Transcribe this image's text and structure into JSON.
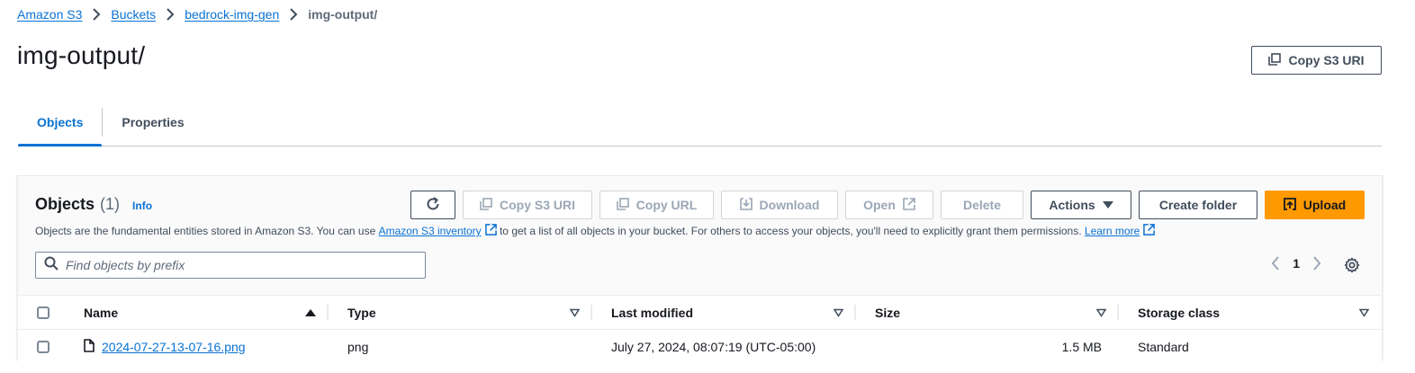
{
  "breadcrumb": {
    "items": [
      "Amazon S3",
      "Buckets",
      "bedrock-img-gen"
    ],
    "current": "img-output/"
  },
  "page": {
    "title": "img-output/",
    "copy_uri_label": "Copy S3 URI"
  },
  "tabs": [
    {
      "label": "Objects",
      "active": true
    },
    {
      "label": "Properties",
      "active": false
    }
  ],
  "objects_panel": {
    "title": "Objects",
    "count": "(1)",
    "info": "Info",
    "description_parts": {
      "before": "Objects are the fundamental entities stored in Amazon S3. You can use ",
      "inventory_link": "Amazon S3 inventory",
      "middle": " to get a list of all objects in your bucket. For others to access your objects, you'll need to explicitly grant them permissions. ",
      "learn_more": "Learn more"
    },
    "toolbar": {
      "copy_s3_uri": "Copy S3 URI",
      "copy_url": "Copy URL",
      "download": "Download",
      "open": "Open",
      "delete": "Delete",
      "actions": "Actions",
      "create_folder": "Create folder",
      "upload": "Upload"
    },
    "search_placeholder": "Find objects by prefix",
    "pagination": {
      "current_page": "1"
    }
  },
  "table": {
    "columns": [
      "Name",
      "Type",
      "Last modified",
      "Size",
      "Storage class"
    ],
    "rows": [
      {
        "name": "2024-07-27-13-07-16.png",
        "type": "png",
        "last_modified": "July 27, 2024, 08:07:19 (UTC-05:00)",
        "size": "1.5 MB",
        "storage_class": "Standard"
      }
    ]
  },
  "colors": {
    "link": "#0972d3",
    "primary_button": "#ff9900",
    "text": "#16191f",
    "disabled": "#9ba7b6"
  }
}
